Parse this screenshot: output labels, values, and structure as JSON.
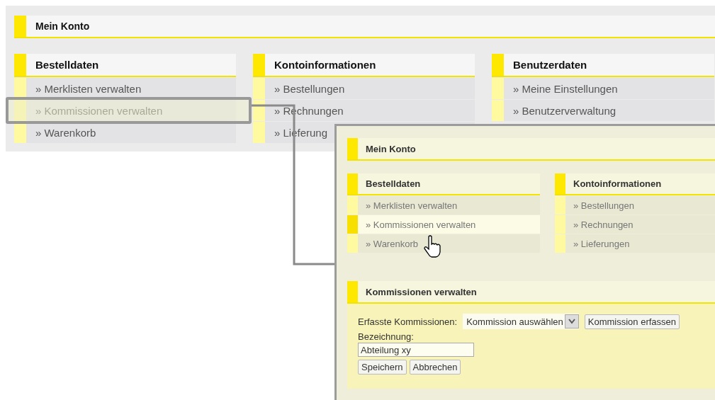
{
  "page": {
    "title": "Mein Konto",
    "columns": [
      {
        "heading": "Bestelldaten",
        "items": [
          {
            "label": "» Merklisten verwalten",
            "highlighted": false
          },
          {
            "label": "» Kommissionen verwalten",
            "highlighted": true
          },
          {
            "label": "» Warenkorb",
            "highlighted": false
          }
        ]
      },
      {
        "heading": "Kontoinformationen",
        "items": [
          {
            "label": "» Bestellungen",
            "highlighted": false
          },
          {
            "label": "» Rechnungen",
            "highlighted": false
          },
          {
            "label": "» Lieferung",
            "highlighted": false
          }
        ]
      },
      {
        "heading": "Benutzerdaten",
        "items": [
          {
            "label": "» Meine Einstellungen",
            "highlighted": false
          },
          {
            "label": "» Benutzerverwaltung",
            "highlighted": false
          }
        ]
      }
    ]
  },
  "zoom_panel": {
    "title": "Mein Konto",
    "columns": [
      {
        "heading": "Bestelldaten",
        "items": [
          {
            "label": "» Merklisten verwalten",
            "selected": false
          },
          {
            "label": "» Kommissionen verwalten",
            "selected": true
          },
          {
            "label": "» Warenkorb",
            "selected": false
          }
        ]
      },
      {
        "heading": "Kontoinformationen",
        "items": [
          {
            "label": "» Bestellungen",
            "selected": false
          },
          {
            "label": "» Rechnungen",
            "selected": false
          },
          {
            "label": "» Lieferungen",
            "selected": false
          }
        ]
      }
    ],
    "form": {
      "title": "Kommissionen verwalten",
      "select_label": "Erfasste Kommissionen:",
      "select_value": "Kommission auswählen",
      "add_button": "Kommission erfassen",
      "name_label": "Bezeichnung:",
      "name_value": "Abteilung xy",
      "buttons": [
        "Speichern",
        "Abbrechen"
      ]
    }
  }
}
